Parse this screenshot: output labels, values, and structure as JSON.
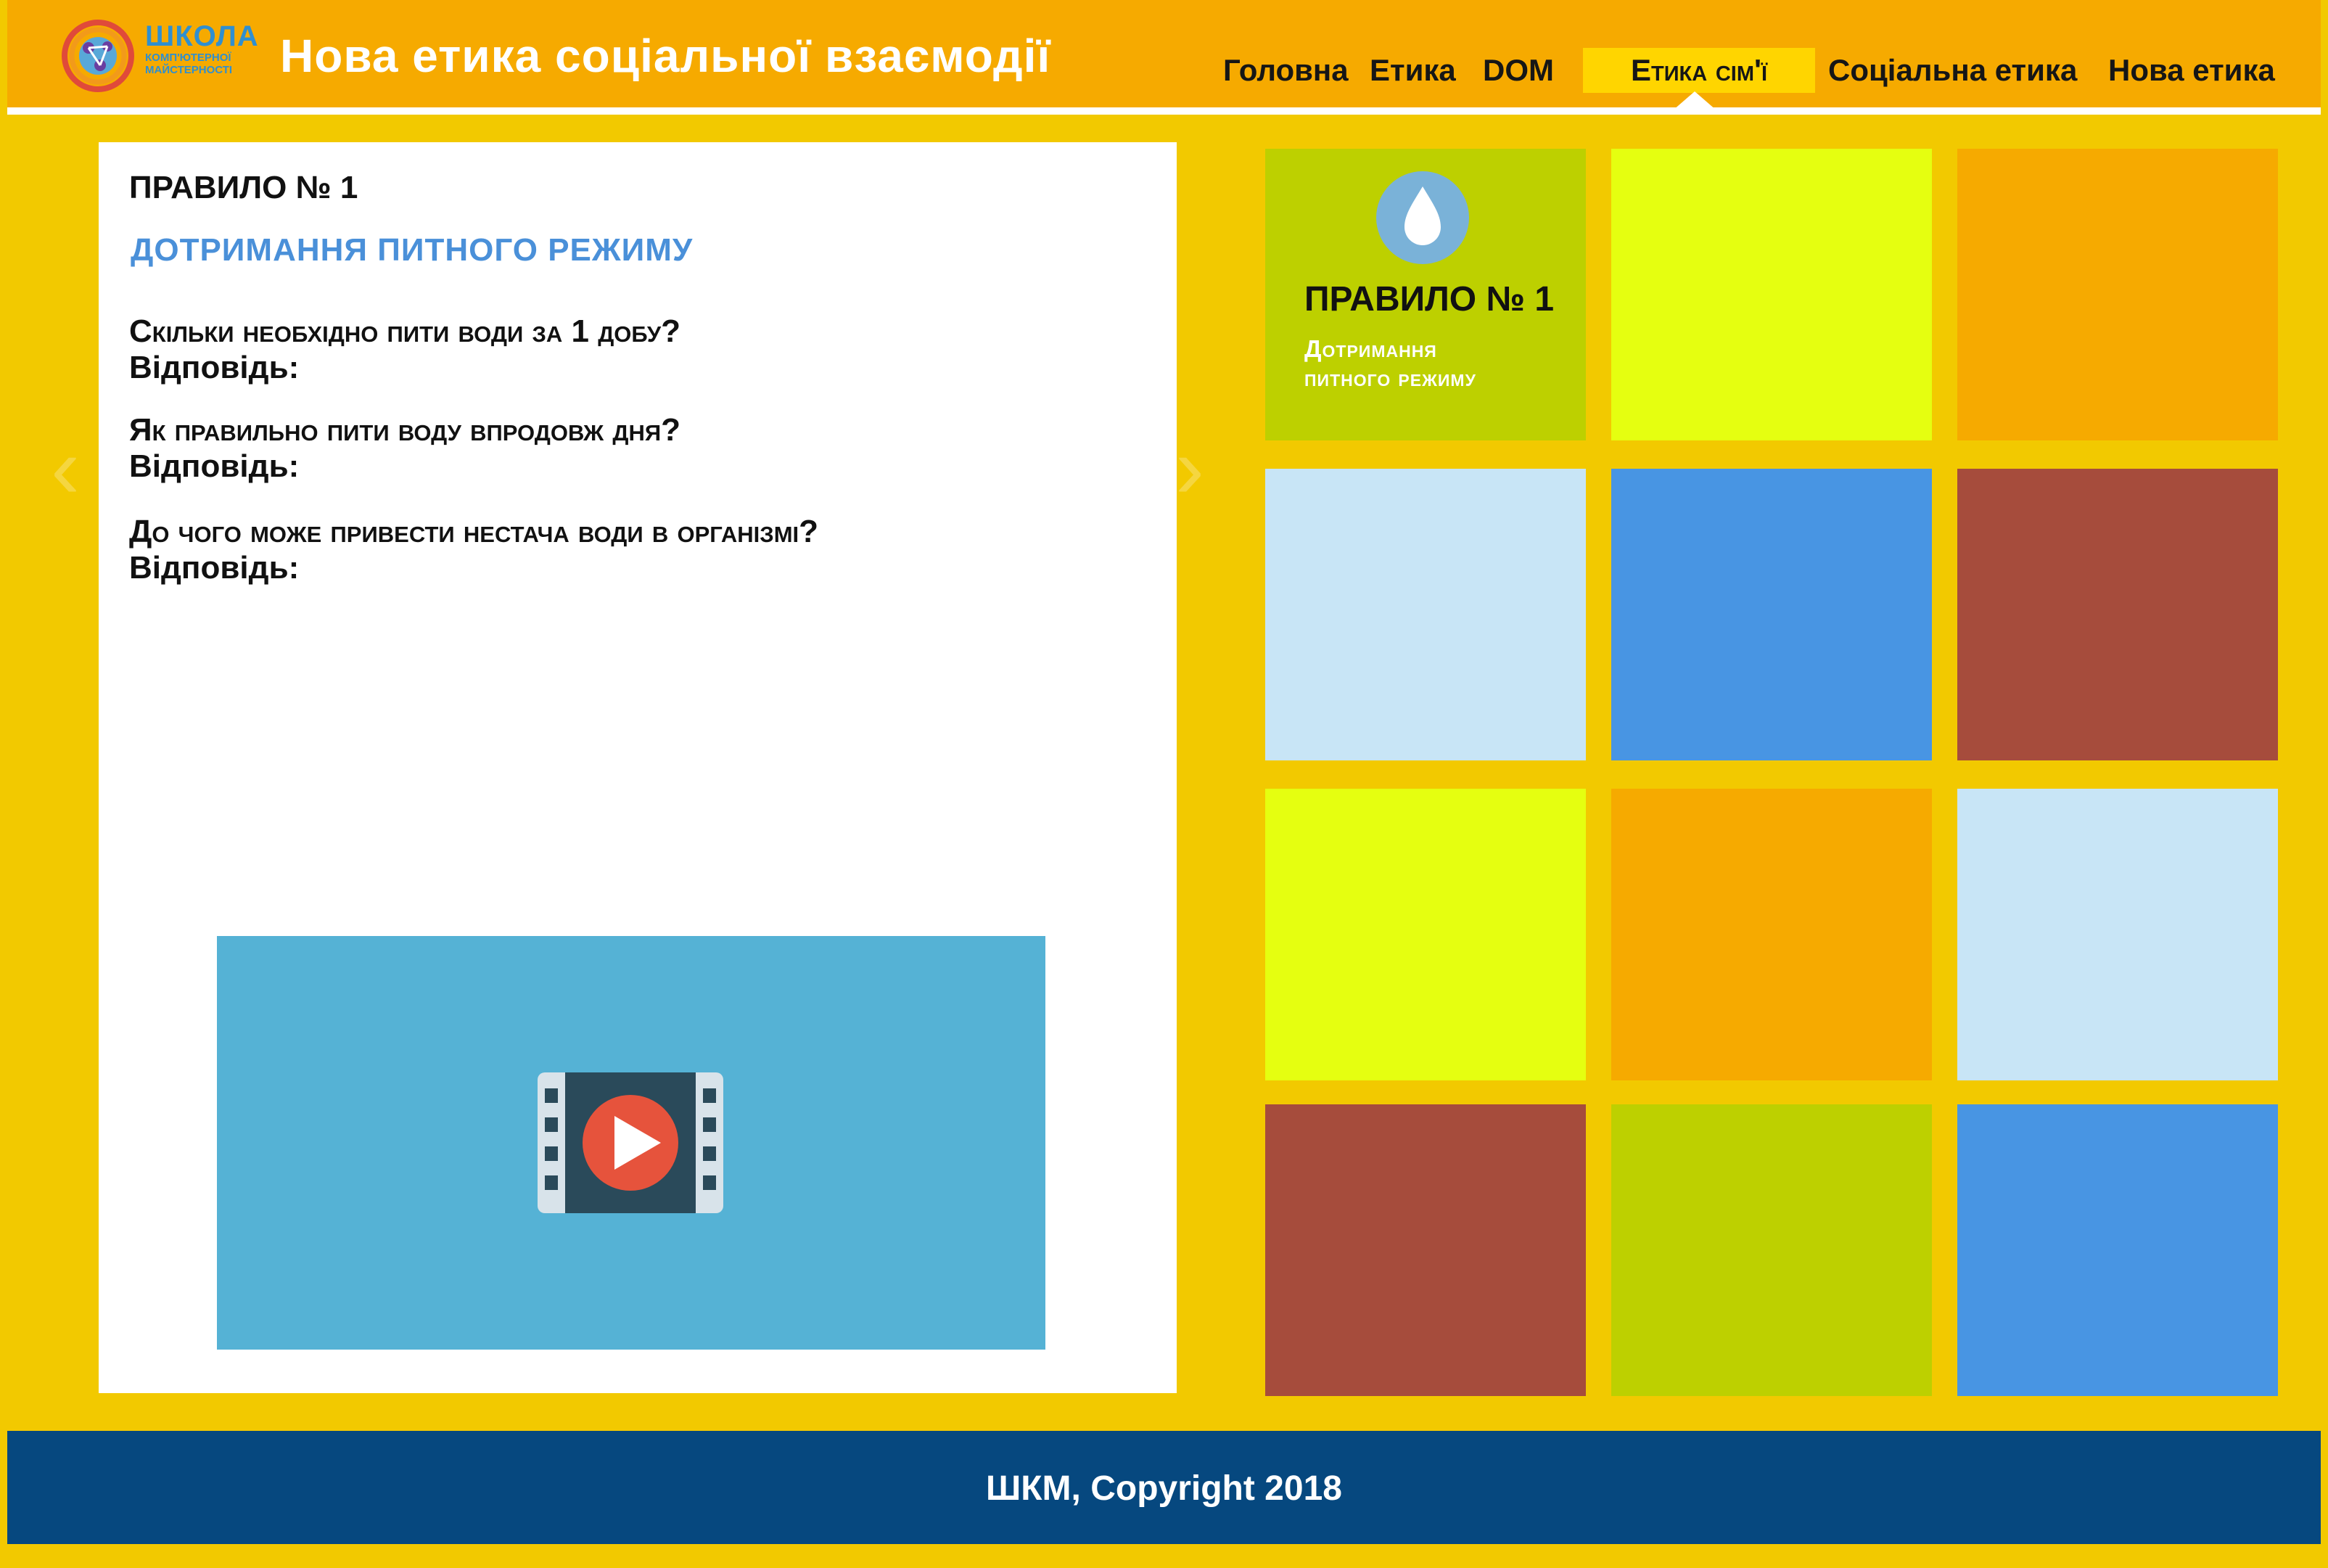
{
  "header": {
    "logo": {
      "line1": "ШКОЛА",
      "line2": "КОМП'ЮТЕРНОЇ",
      "line3": "МАЙСТЕРНОСТІ"
    },
    "title": "Нова етика соціальної взаємодії",
    "nav": [
      {
        "label": "Головна",
        "active": false
      },
      {
        "label": "Етика",
        "active": false
      },
      {
        "label": "DOM",
        "active": false
      },
      {
        "label": "Етика сім'ї",
        "active": true
      },
      {
        "label": "Соціальна етика",
        "active": false
      },
      {
        "label": "Нова етика",
        "active": false
      }
    ]
  },
  "panel": {
    "heading": "ПРАВИЛО № 1",
    "subheading": "ДОТРИМАННЯ ПИТНОГО РЕЖИМУ",
    "qa": [
      {
        "question": "Скільки необхідно пити води за 1 добу?",
        "answer": "Відповідь:"
      },
      {
        "question": "Як правильно пити воду впродовж дня?",
        "answer": "Відповідь:"
      },
      {
        "question": "До чого може привести нестача води в організмі?",
        "answer": "Відповідь:"
      }
    ],
    "video": {
      "icon": "film-play-icon",
      "color": "#55b2d5"
    }
  },
  "tiles": [
    {
      "color": "#bdd000",
      "title": "ПРАВИЛО № 1",
      "subtitle_line1": "Дотримання",
      "subtitle_line2": "питного режиму",
      "icon": "water-drop-icon"
    },
    {
      "color": "#e5ff10"
    },
    {
      "color": "#f6aa00"
    },
    {
      "color": "#c8e5f6"
    },
    {
      "color": "#4895e3"
    },
    {
      "color": "#a64c3c"
    },
    {
      "color": "#e5ff10"
    },
    {
      "color": "#f6aa00"
    },
    {
      "color": "#c8e5f6"
    },
    {
      "color": "#a64c3c"
    },
    {
      "color": "#bdd000"
    },
    {
      "color": "#4895e3"
    }
  ],
  "footer": {
    "text": "ШКМ, Copyright 2018"
  },
  "colors": {
    "background": "#f2c900",
    "header": "#f6aa00",
    "footer": "#06487f",
    "accent_blue": "#4a90d9",
    "nav_active": "#ffd500"
  }
}
